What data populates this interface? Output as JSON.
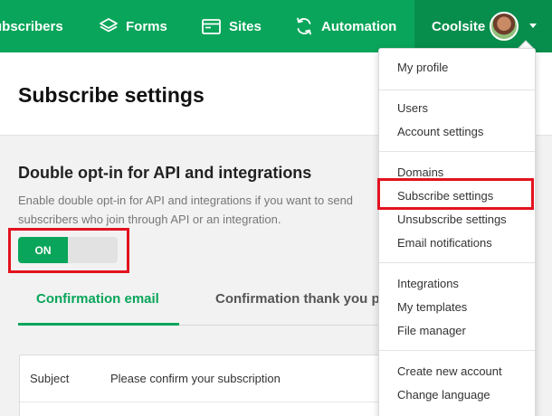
{
  "nav": {
    "items": [
      {
        "label": "ubscribers"
      },
      {
        "label": "Forms",
        "icon": "layers-icon"
      },
      {
        "label": "Sites",
        "icon": "browser-window-icon"
      },
      {
        "label": "Automation",
        "icon": "refresh-icon"
      }
    ],
    "account_name": "Coolsite"
  },
  "page": {
    "title": "Subscribe settings"
  },
  "double_optin": {
    "title": "Double opt-in for API and integrations",
    "description": "Enable double opt-in for API and integrations if you want to send subscribers who join through API or an integration.",
    "toggle_label": "ON",
    "enabled": true
  },
  "tabs": [
    {
      "label": "Confirmation email",
      "active": true
    },
    {
      "label": "Confirmation thank you p",
      "active": false
    }
  ],
  "form": {
    "subject_label": "Subject",
    "subject_value": "Please confirm your subscription"
  },
  "menu": {
    "groups": [
      [
        "My profile"
      ],
      [
        "Users",
        "Account settings"
      ],
      [
        "Domains",
        "Subscribe settings",
        "Unsubscribe settings",
        "Email notifications"
      ],
      [
        "Integrations",
        "My templates",
        "File manager"
      ],
      [
        "Create new account",
        "Change language"
      ]
    ],
    "highlighted": "Subscribe settings"
  },
  "colors": {
    "brand_green": "#09a55a",
    "highlight_red": "#e3121f"
  }
}
